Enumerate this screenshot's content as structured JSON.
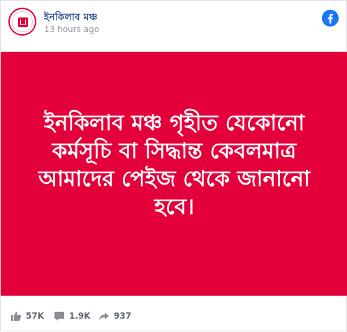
{
  "post": {
    "page_name": "ইনকিলাব মঞ্চ",
    "timestamp": "13 hours ago",
    "banner_text": "ইনকিলাব মঞ্চ গৃহীত যেকোনো কর্মসূচি বা সিদ্ধান্ত কেবলমাত্র আমাদের পেইজ থেকে জানানো হবে।",
    "banner_color": "#e3003b"
  },
  "stats": {
    "likes": "57K",
    "comments": "1.9K",
    "shares": "937"
  },
  "icons": {
    "network": "facebook-icon",
    "likes": "thumbs-up-icon",
    "comments": "comment-icon",
    "shares": "share-arrow-icon"
  },
  "colors": {
    "accent": "#e3003b",
    "link": "#385898",
    "facebook": "#1877f2",
    "muted": "#606770"
  }
}
